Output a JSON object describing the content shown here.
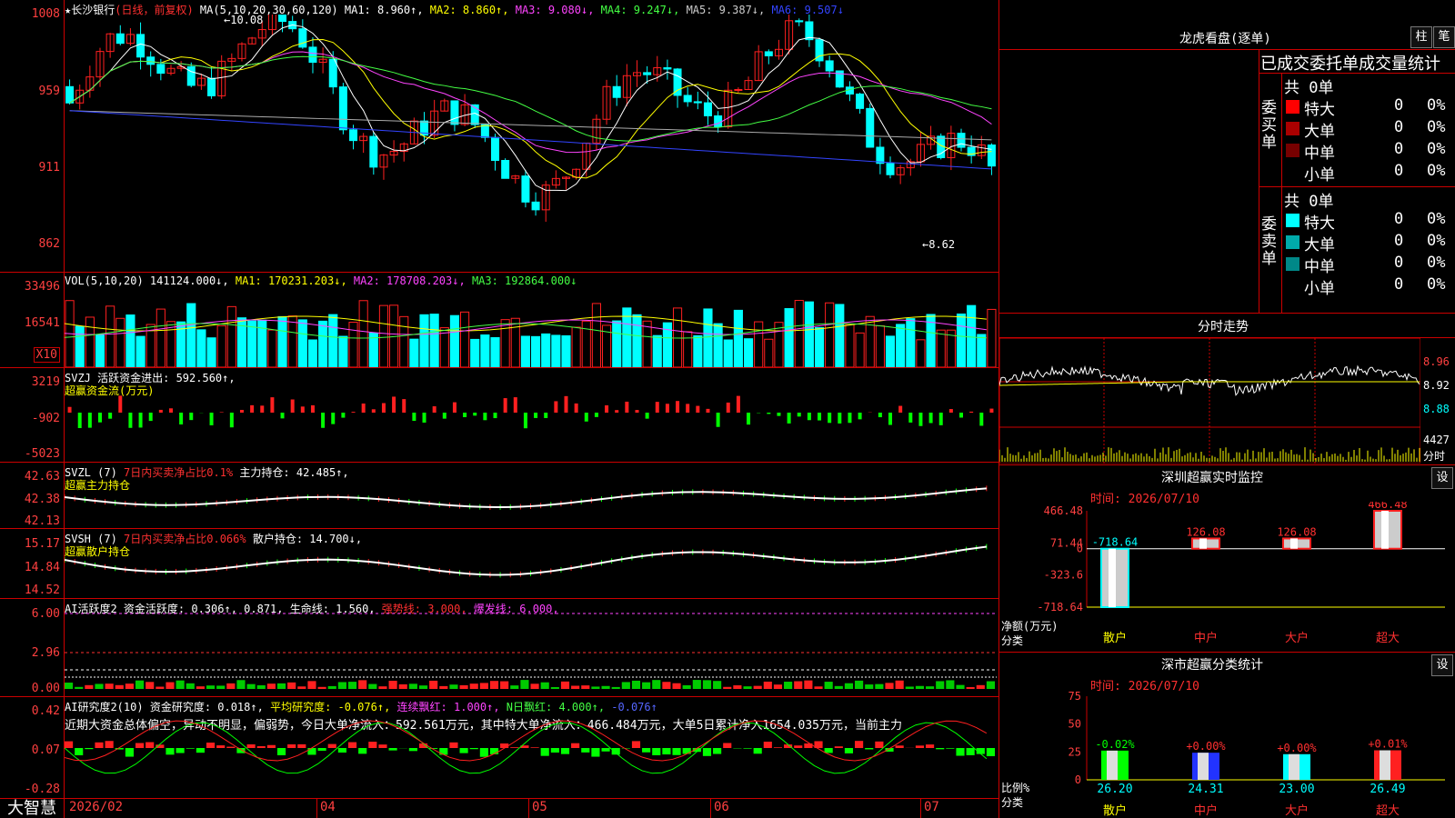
{
  "stock": {
    "title": "★长沙银行",
    "mode": "(日线，前复权)"
  },
  "main_chart": {
    "ma_header": [
      {
        "text": "MA(5,10,20,30,60,120)",
        "color": "#ffffff"
      },
      {
        "text": "MA1: 8.960↑,",
        "color": "#ffffff"
      },
      {
        "text": "MA2: 8.860↑,",
        "color": "#ffff00"
      },
      {
        "text": "MA3: 9.080↓,",
        "color": "#ff44ff"
      },
      {
        "text": "MA4: 9.247↓,",
        "color": "#44ff44"
      },
      {
        "text": "MA5: 9.387↓,",
        "color": "#cccccc"
      },
      {
        "text": "MA6: 9.507↓",
        "color": "#3344ff"
      }
    ],
    "y_labels": [
      "1008",
      "959",
      "911",
      "862"
    ],
    "high_label": "10.08",
    "low_label": "8.62"
  },
  "vol": {
    "header": [
      {
        "text": "VOL(5,10,20)",
        "color": "#ffffff"
      },
      {
        "text": "141124.000↓,",
        "color": "#ffffff"
      },
      {
        "text": "MA1: 170231.203↓,",
        "color": "#ffff00"
      },
      {
        "text": "MA2: 178708.203↓,",
        "color": "#ff44ff"
      },
      {
        "text": "MA3: 192864.000↓",
        "color": "#44ff44"
      }
    ],
    "y_labels": [
      "33496",
      "16541"
    ],
    "unit": "X10"
  },
  "svzj": {
    "header": [
      {
        "text": "SVZJ",
        "color": "#ffffff"
      },
      {
        "text": "活跃资金进出: 592.560↑,",
        "color": "#ffffff"
      }
    ],
    "subtitle": "超赢资金流(万元)",
    "y_labels": [
      "3219",
      "-902",
      "-5023"
    ]
  },
  "svzl": {
    "header": [
      {
        "text": "SVZL (7)",
        "color": "#ffffff"
      },
      {
        "text": "7日内买卖净占比0.1%",
        "color": "#ff3030"
      },
      {
        "text": "主力持仓: 42.485↑,",
        "color": "#ffffff"
      }
    ],
    "subtitle": "超赢主力持仓",
    "y_labels": [
      "42.63",
      "42.38",
      "42.13"
    ]
  },
  "svsh": {
    "header": [
      {
        "text": "SVSH (7)",
        "color": "#ffffff"
      },
      {
        "text": "7日内买卖净占比0.066%",
        "color": "#ff3030"
      },
      {
        "text": "散户持仓: 14.700↓,",
        "color": "#ffffff"
      }
    ],
    "subtitle": "超赢散户持仓",
    "y_labels": [
      "15.17",
      "14.84",
      "14.52"
    ]
  },
  "ai_active": {
    "header": [
      {
        "text": "AI活跃度2",
        "color": "#ffffff"
      },
      {
        "text": "资金活跃度: 0.306↑,",
        "color": "#ffffff"
      },
      {
        "text": "0.871,",
        "color": "#ffffff"
      },
      {
        "text": "生命线: 1.560,",
        "color": "#ffffff"
      },
      {
        "text": "强势线: 3.000,",
        "color": "#ff3030"
      },
      {
        "text": "爆发线: 6.000,",
        "color": "#ff44ff"
      }
    ],
    "y_labels": [
      "6.00",
      "2.96",
      "0.00"
    ]
  },
  "ai_research": {
    "header": [
      {
        "text": "AI研究度2(10)",
        "color": "#ffffff"
      },
      {
        "text": "资金研究度: 0.018↑,",
        "color": "#ffffff"
      },
      {
        "text": "平均研究度: -0.076↑,",
        "color": "#ffff00"
      },
      {
        "text": "连续飘红: 1.000↑,",
        "color": "#ff44ff"
      },
      {
        "text": "N日飘红: 4.000↑,",
        "color": "#44ff44"
      },
      {
        "text": "-0.076↑",
        "color": "#5566ff"
      }
    ],
    "note": "近期大资金总体偏空，异动不明显，偏弱势，今日大单净流入：592.561万元，其中特大单净流入：466.484万元，大单5日累计净入1654.035万元，当前主力",
    "y_labels": [
      "0.42",
      "0.07",
      "-0.28"
    ]
  },
  "x_axis": {
    "labels": [
      "2026/02",
      "04",
      "05",
      "06",
      "07"
    ]
  },
  "brand": "大智慧",
  "lhb": {
    "title": "龙虎看盘(逐单)",
    "btn_bar": "柱",
    "btn_line": "笔",
    "header": "已成交委托单成交量统计",
    "buy_label": "委买单",
    "sell_label": "委卖单",
    "buy_total": "共 0单",
    "sell_total": "共 0单",
    "buy_rows": [
      {
        "name": "特大",
        "count": "0",
        "pct": "0%",
        "color": "#ff0000"
      },
      {
        "name": "大单",
        "count": "0",
        "pct": "0%",
        "color": "#aa0000"
      },
      {
        "name": "中单",
        "count": "0",
        "pct": "0%",
        "color": "#770000"
      },
      {
        "name": "小单",
        "count": "0",
        "pct": "0%",
        "color": ""
      }
    ],
    "sell_rows": [
      {
        "name": "特大",
        "count": "0",
        "pct": "0%",
        "color": "#00ffff"
      },
      {
        "name": "大单",
        "count": "0",
        "pct": "0%",
        "color": "#00aaaa"
      },
      {
        "name": "中单",
        "count": "0",
        "pct": "0%",
        "color": "#008888"
      },
      {
        "name": "小单",
        "count": "0",
        "pct": "0%",
        "color": ""
      }
    ]
  },
  "intraday": {
    "title": "分时走势",
    "y_labels": [
      "8.96",
      "8.92",
      "8.88"
    ],
    "vol_label": "4427",
    "vol_unit": "分时"
  },
  "sz_monitor": {
    "title": "深圳超赢实时监控",
    "btn": "设",
    "date": "时间: 2026/07/10",
    "y_labels": [
      "466.48",
      "71.44",
      "0",
      "-323.6",
      "-718.64"
    ],
    "side_label_1": "净额(万元)",
    "side_label_2": "分类",
    "bars": [
      {
        "label": "散户",
        "value": -718.64,
        "text": "-718.64",
        "textcolor": "#00ffff",
        "labelcolor": "#ffff00"
      },
      {
        "label": "中户",
        "value": 126.08,
        "text": "126.08",
        "textcolor": "#ff3030",
        "labelcolor": "#ff3030"
      },
      {
        "label": "大户",
        "value": 126.08,
        "text": "126.08",
        "textcolor": "#ff3030",
        "labelcolor": "#ff3030"
      },
      {
        "label": "超大",
        "value": 466.48,
        "text": "466.48",
        "textcolor": "#ff3030",
        "labelcolor": "#ff3030"
      }
    ]
  },
  "sz_class": {
    "title": "深市超赢分类统计",
    "btn": "设",
    "date": "时间: 2026/07/10",
    "y_labels": [
      "75",
      "50",
      "25",
      "0"
    ],
    "side_label_1": "比例%",
    "side_label_2": "分类",
    "bars": [
      {
        "label": "散户",
        "value": 26.2,
        "text": "26.20",
        "delta": "-0.02%",
        "fill": "#00ff00",
        "labelcolor": "#ffff00",
        "deltacolor": "#00ff00"
      },
      {
        "label": "中户",
        "value": 24.31,
        "text": "24.31",
        "delta": "+0.00%",
        "fill": "#2233ff",
        "labelcolor": "#ff3030",
        "deltacolor": "#ff3030"
      },
      {
        "label": "大户",
        "value": 23.0,
        "text": "23.00",
        "delta": "+0.00%",
        "fill": "#00ffff",
        "labelcolor": "#ff3030",
        "deltacolor": "#ff3030"
      },
      {
        "label": "超大",
        "value": 26.49,
        "text": "26.49",
        "delta": "+0.01%",
        "fill": "#ff2020",
        "labelcolor": "#ff3030",
        "deltacolor": "#ff3030"
      }
    ]
  }
}
